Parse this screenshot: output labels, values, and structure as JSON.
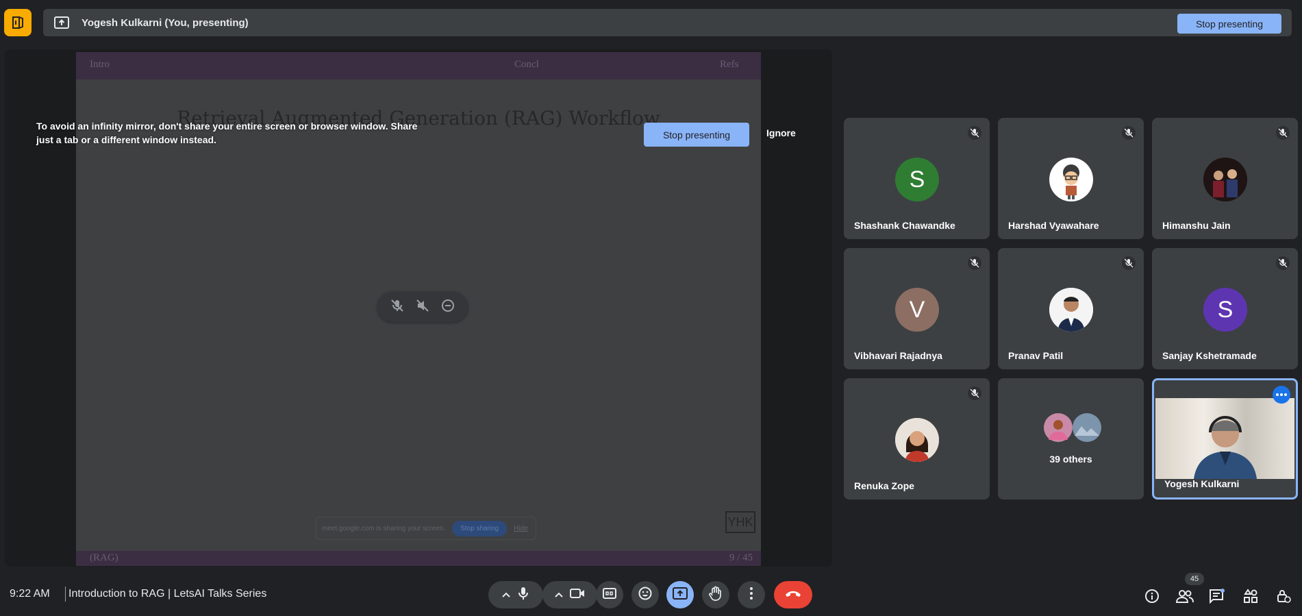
{
  "topbar": {
    "title": "Yogesh Kulkarni (You, presenting)",
    "stop_label": "Stop presenting"
  },
  "stage": {
    "warning": "To avoid an infinity mirror, don't share your entire screen or browser window. Share just a tab or a different window instead.",
    "stop_label": "Stop presenting",
    "ignore_label": "Ignore",
    "slide": {
      "nav": [
        "Intro",
        "Concl",
        "Refs"
      ],
      "title": "Retrieval Augmented Generation (RAG) Workflow",
      "footer_left": "(RAG)",
      "footer_right": "9 / 45",
      "logo_text": "YHK",
      "share_text": "meet.google.com is sharing your screen.",
      "share_stop": "Stop sharing",
      "share_hide": "Hide"
    }
  },
  "participants": [
    {
      "name": "Shashank Chawandke",
      "initial": "S",
      "color": "#2e7d32"
    },
    {
      "name": "Harshad Vyawahare",
      "initial": "",
      "color": "#ffffff"
    },
    {
      "name": "Himanshu Jain",
      "initial": "",
      "color": "#3a1f1f"
    },
    {
      "name": "Vibhavari Rajadnya",
      "initial": "V",
      "color": "#8d6e63"
    },
    {
      "name": "Pranav Patil",
      "initial": "",
      "color": "#ffffff"
    },
    {
      "name": "Sanjay Kshetramade",
      "initial": "S",
      "color": "#5e35b1"
    },
    {
      "name": "Renuka Zope",
      "initial": "",
      "color": "#d7ccc8"
    }
  ],
  "others_label": "39 others",
  "self_name": "Yogesh Kulkarni",
  "bottom": {
    "time": "9:22 AM",
    "meeting": "Introduction to RAG | LetsAI Talks Series",
    "people_count": "45"
  },
  "colors": {
    "accent": "#8ab4f8",
    "end_call": "#ea4335",
    "background": "#202124",
    "logo": "#f9ab00"
  }
}
